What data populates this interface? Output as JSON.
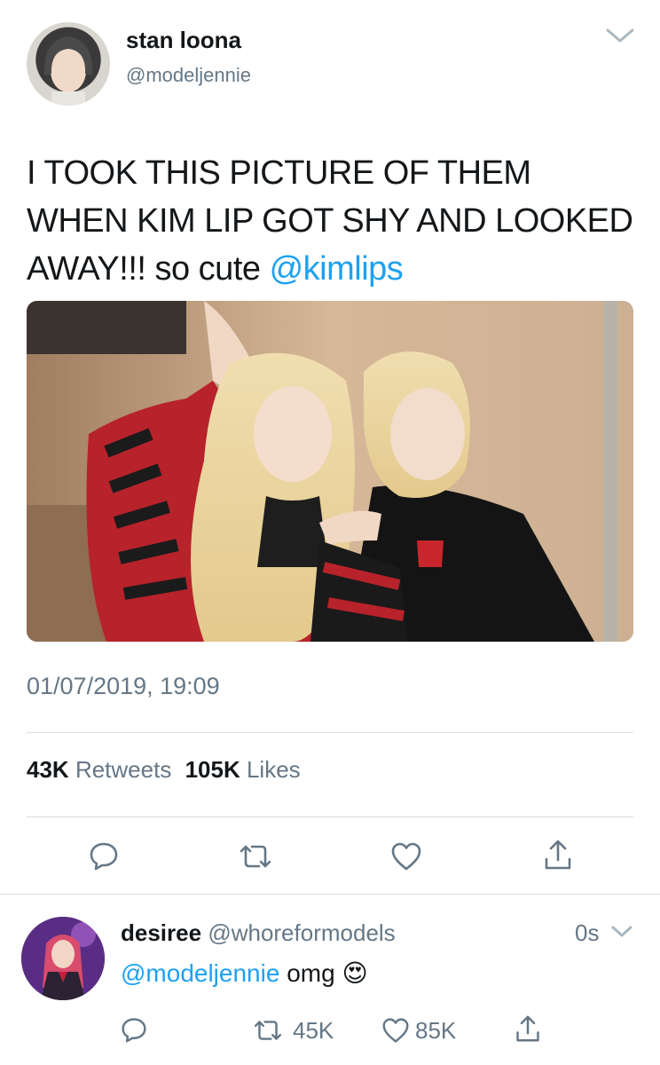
{
  "tweet": {
    "display_name": "stan loona",
    "handle": "@modeljennie",
    "text_main": "I TOOK THIS PICTURE OF THEM WHEN KIM LIP GOT SHY AND LOOKED AWAY!!! so cute",
    "mention": "@kimlips",
    "timestamp": "01/07/2019, 19:09",
    "retweets_count": "43K",
    "retweets_label": "Retweets",
    "likes_count": "105K",
    "likes_label": "Likes",
    "icons": {
      "more": "chevron-down-icon",
      "reply": "reply-icon",
      "retweet": "retweet-icon",
      "like": "heart-icon",
      "share": "share-icon"
    }
  },
  "reply": {
    "display_name": "desiree",
    "handle": "@whoreformodels",
    "time": "0s",
    "mention": "@modeljennie",
    "text": "omg",
    "emoji": "😍",
    "retweet_count": "45K",
    "like_count": "85K"
  },
  "colors": {
    "link": "#1da1f2",
    "muted": "#657786",
    "divider": "#d8dde2"
  }
}
